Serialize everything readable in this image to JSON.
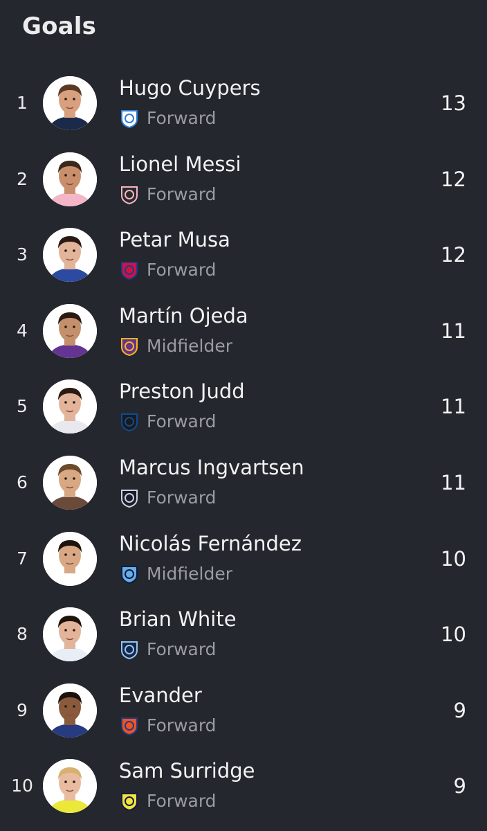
{
  "header": {
    "title": "Goals"
  },
  "players": [
    {
      "rank": "1",
      "name": "Hugo Cuypers",
      "position": "Forward",
      "goals": "13",
      "club_icon": "chicago-fire-icon",
      "club_color": "#ffffff",
      "club_accent": "#2f7fd4",
      "shirt_color": "#1c2a4a",
      "skin": "#d9a07f",
      "hair": "#5a3a22"
    },
    {
      "rank": "2",
      "name": "Lionel Messi",
      "position": "Forward",
      "goals": "12",
      "club_icon": "inter-miami-icon",
      "club_color": "#2a2a2a",
      "club_accent": "#f4b6c7",
      "shirt_color": "#f4b6c7",
      "skin": "#c98f6c",
      "hair": "#3a2818"
    },
    {
      "rank": "3",
      "name": "Petar Musa",
      "position": "Forward",
      "goals": "12",
      "club_icon": "fc-dallas-icon",
      "club_color": "#d11241",
      "club_accent": "#1f3a8a",
      "shirt_color": "#2b4aa0",
      "skin": "#e2b49a",
      "hair": "#2a1a12"
    },
    {
      "rank": "4",
      "name": "Martín Ojeda",
      "position": "Midfielder",
      "goals": "11",
      "club_icon": "orlando-city-icon",
      "club_color": "#633492",
      "club_accent": "#fdb515",
      "shirt_color": "#633492",
      "skin": "#c4906c",
      "hair": "#2a1a12"
    },
    {
      "rank": "5",
      "name": "Preston Judd",
      "position": "Forward",
      "goals": "11",
      "club_icon": "san-jose-icon",
      "club_color": "#1a1a1a",
      "club_accent": "#0d4c92",
      "shirt_color": "#e8e8ee",
      "skin": "#e2b49a",
      "hair": "#2a1a12"
    },
    {
      "rank": "6",
      "name": "Marcus Ingvartsen",
      "position": "Forward",
      "goals": "11",
      "club_icon": "san-diego-icon",
      "club_color": "#1b1b2e",
      "club_accent": "#cfd3db",
      "shirt_color": "#6b4a3a",
      "skin": "#d8a884",
      "hair": "#6a4a2a"
    },
    {
      "rank": "7",
      "name": "Nicolás Fernández",
      "position": "Midfielder",
      "goals": "10",
      "club_icon": "nycfc-icon",
      "club_color": "#6cace4",
      "club_accent": "#041e42",
      "shirt_color": "#ffffff",
      "skin": "#d8a884",
      "hair": "#1e140c"
    },
    {
      "rank": "8",
      "name": "Brian White",
      "position": "Forward",
      "goals": "10",
      "club_icon": "vancouver-icon",
      "club_color": "#12284c",
      "club_accent": "#9dc2ea",
      "shirt_color": "#e8eef6",
      "skin": "#e2b49a",
      "hair": "#1e140c"
    },
    {
      "rank": "9",
      "name": "Evander",
      "position": "Forward",
      "goals": "9",
      "club_icon": "fc-cincinnati-icon",
      "club_color": "#f05323",
      "club_accent": "#263b80",
      "shirt_color": "#263b80",
      "skin": "#8a5a3c",
      "hair": "#1a120c"
    },
    {
      "rank": "10",
      "name": "Sam Surridge",
      "position": "Forward",
      "goals": "9",
      "club_icon": "nashville-icon",
      "club_color": "#ece83a",
      "club_accent": "#1f1646",
      "shirt_color": "#ece83a",
      "skin": "#e8bca0",
      "hair": "#d9b070"
    }
  ]
}
